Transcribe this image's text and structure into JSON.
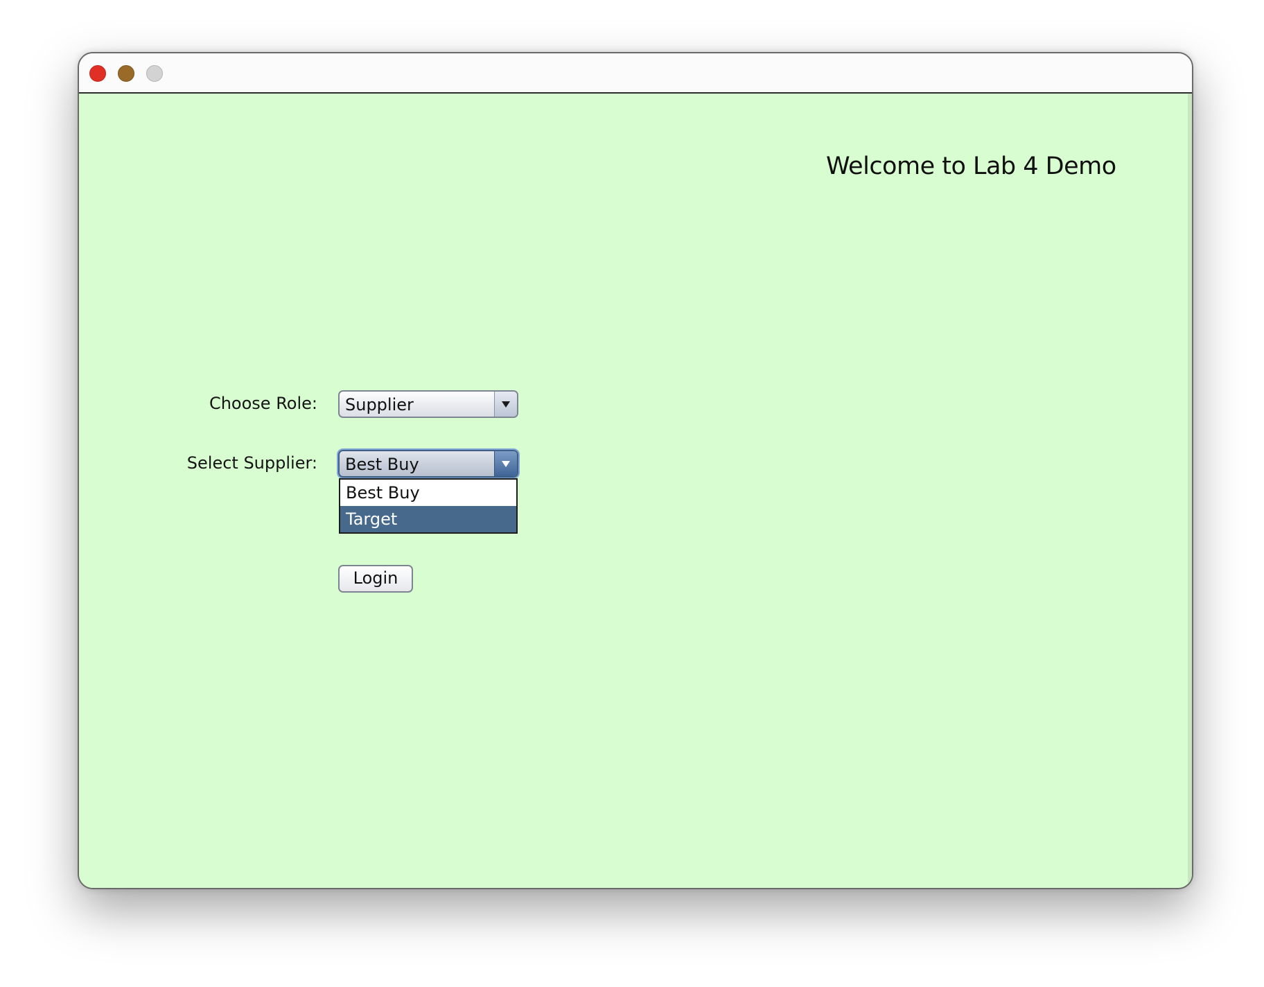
{
  "window": {
    "controls": {
      "close": "close-icon",
      "minimize": "minimize-icon",
      "zoom": "zoom-icon"
    }
  },
  "main": {
    "welcome_text": "Welcome to Lab 4 Demo",
    "role_label": "Choose Role:",
    "role_value": "Supplier",
    "supplier_label": "Select Supplier:",
    "supplier_value": "Best Buy",
    "supplier_options": [
      {
        "label": "Best Buy",
        "selected": false
      },
      {
        "label": "Target",
        "selected": true
      }
    ],
    "login_label": "Login"
  },
  "colors": {
    "background": "#d8fdd0",
    "selection": "#476a8c",
    "close": "#e03025",
    "minimize": "#9a6a28",
    "zoom": "#d3d3d3"
  }
}
